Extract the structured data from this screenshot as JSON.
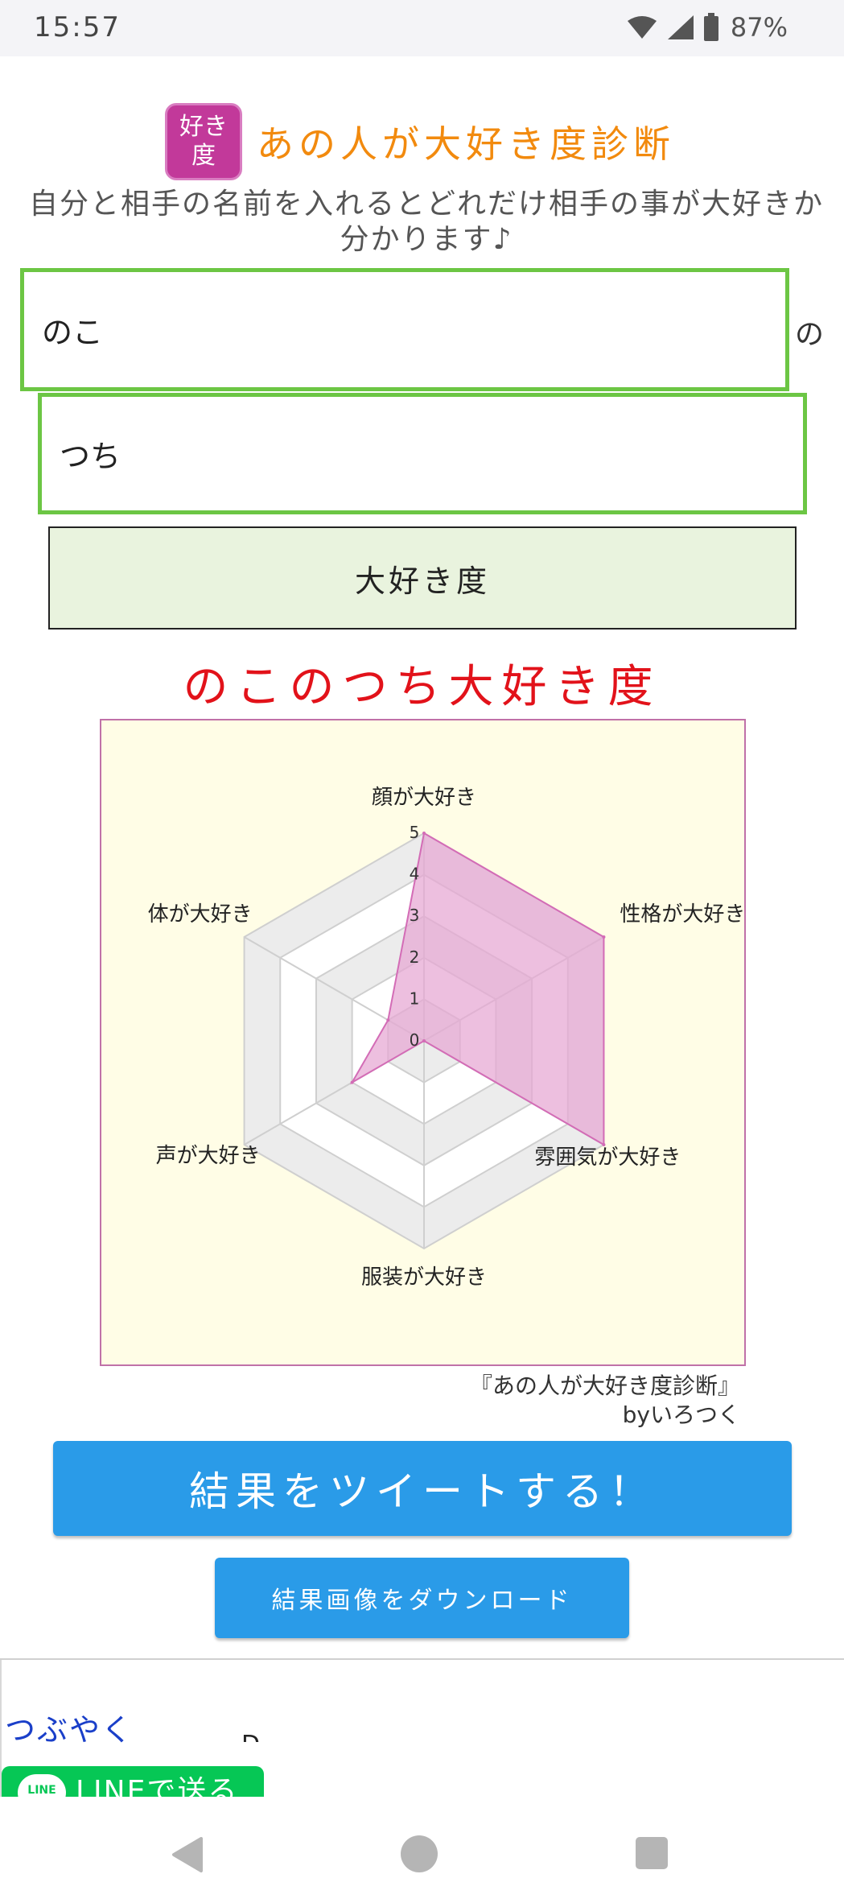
{
  "status_bar": {
    "time": "15:57",
    "battery": "87%",
    "icons": [
      "wifi-icon",
      "signal-icon",
      "battery-icon"
    ]
  },
  "header": {
    "logo_text": "好き度",
    "title": "あの人が大好き度診断",
    "subtitle": "自分と相手の名前を入れるとどれだけ相手の事が大好きか分かります♪"
  },
  "form": {
    "name1_value": "のこ",
    "particle": "の",
    "name2_value": "つち",
    "submit_label": "大好き度"
  },
  "result": {
    "title": "のこのつち大好き度"
  },
  "chart_data": {
    "type": "radar",
    "title": "",
    "categories": [
      "顔が大好き",
      "性格が大好き",
      "雰囲気が大好き",
      "服装が大好き",
      "声が大好き",
      "体が大好き"
    ],
    "series": [
      {
        "values": [
          5,
          5,
          5,
          0,
          2,
          1
        ]
      }
    ],
    "rlim": [
      0,
      5
    ],
    "ticks": [
      "0",
      "1",
      "2",
      "3",
      "4",
      "5"
    ],
    "colors": {
      "fill": "#e6a6d2",
      "stroke": "#d36cb6",
      "background": "#fffde6",
      "grid": "#cfcfcf",
      "bands": [
        "#ececec",
        "#ffffff"
      ]
    }
  },
  "credit": {
    "line1": "『あの人が大好き度診断』",
    "line2": "byいろつく"
  },
  "actions": {
    "tweet_label": "結果をツイートする！",
    "download_label": "結果画像をダウンロード"
  },
  "share": {
    "tweet_link": "つぶやく",
    "ad_fragment": "D",
    "line_logo": "LINE",
    "line_label": "LINEで送る"
  }
}
